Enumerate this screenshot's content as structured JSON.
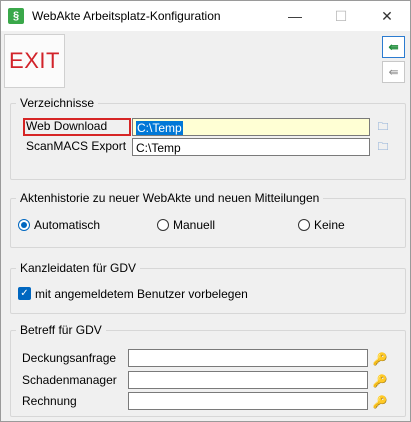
{
  "window": {
    "title": "WebAkte Arbeitsplatz-Konfiguration",
    "app_icon": "§",
    "minimize": "—",
    "maximize": "☐",
    "close": "✕"
  },
  "toolbar": {
    "exit_label": "EXIT",
    "icon_active": "⇚",
    "icon_inactive": "⇚"
  },
  "verzeichnisse": {
    "title": "Verzeichnisse",
    "rows": [
      {
        "label": "Web Download",
        "value": "C:\\Temp"
      },
      {
        "label": "ScanMACS Export",
        "value": "C:\\Temp"
      }
    ]
  },
  "aktenhistorie": {
    "title": "Aktenhistorie zu neuer WebAkte und neuen Mitteilungen",
    "options": [
      "Automatisch",
      "Manuell",
      "Keine"
    ],
    "selected": "Automatisch"
  },
  "kanzleidaten": {
    "title": "Kanzleidaten für GDV",
    "checkbox_label": "mit angemeldetem Benutzer vorbelegen",
    "checked": true
  },
  "betreff": {
    "title": "Betreff für GDV",
    "rows": [
      {
        "label": "Deckungsanfrage",
        "value": ""
      },
      {
        "label": "Schadenmanager",
        "value": ""
      },
      {
        "label": "Rechnung",
        "value": ""
      }
    ]
  },
  "colors": {
    "exit_red": "#d2232a",
    "accent_blue": "#0067c0",
    "highlight_yellow": "#ffffd4",
    "focus_red": "#d62525"
  }
}
